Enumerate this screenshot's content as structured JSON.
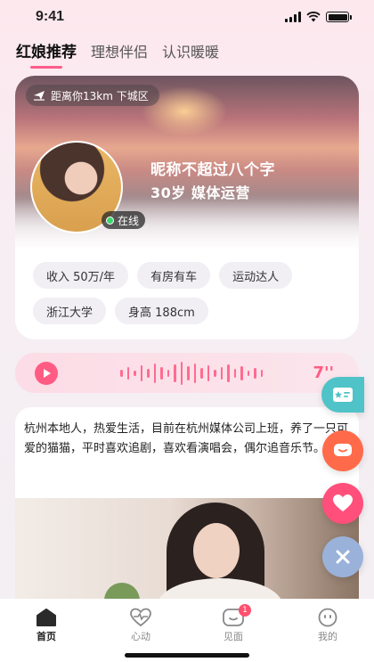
{
  "status_bar": {
    "time": "9:41"
  },
  "tabs": [
    {
      "label": "红娘推荐",
      "active": true
    },
    {
      "label": "理想伴侣",
      "active": false
    },
    {
      "label": "认识暖暖",
      "active": false
    }
  ],
  "profile": {
    "distance": "距离你13km 下城区",
    "online": "在线",
    "nickname": "昵称不超过八个字",
    "age_job": "30岁 媒体运营",
    "tags": [
      "收入 50万/年",
      "有房有车",
      "运动达人",
      "浙江大学",
      "身高 188cm"
    ]
  },
  "voice": {
    "duration": "7''",
    "accent": "#ff5b83"
  },
  "bio": {
    "text": "杭州本地人，热爱生活，目前在杭州媒体公司上班，养了一只可爱的猫猫，平时喜欢追剧，喜欢看演唱会，偶尔追音乐节。"
  },
  "floating_actions": [
    {
      "icon": "id-card-icon"
    },
    {
      "icon": "chat-bubble-icon"
    },
    {
      "icon": "heart-icon"
    },
    {
      "icon": "close-icon"
    }
  ],
  "bottom_nav": {
    "home": "首页",
    "heartbeat": "心动",
    "meet": "见面",
    "meet_badge": "1",
    "mine": "我的"
  }
}
